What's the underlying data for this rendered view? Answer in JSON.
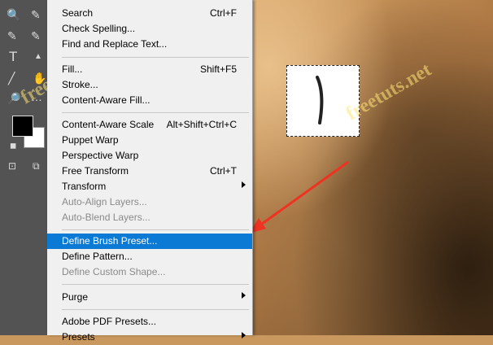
{
  "colors": {
    "menu_bg": "#f0f0f0",
    "highlight": "#0a7ad4",
    "disabled_text": "#8a8a8a",
    "toolbar_bg": "#535353",
    "arrow": "#ee3322"
  },
  "toolbar": {
    "tools": [
      {
        "icon": "zoom-icon",
        "glyph": "🔍"
      },
      {
        "icon": "brush-icon",
        "glyph": "✎"
      },
      {
        "icon": "text-tool-icon",
        "glyph": "T"
      },
      {
        "icon": "path-select-icon",
        "glyph": "▲"
      },
      {
        "icon": "line-tool-icon",
        "glyph": "╱"
      },
      {
        "icon": "hand-tool-icon",
        "glyph": "✋"
      },
      {
        "icon": "magnify-icon",
        "glyph": "🔎"
      },
      {
        "icon": "more-tools-icon",
        "glyph": "…"
      }
    ]
  },
  "menu": {
    "items": [
      {
        "label": "Search",
        "shortcut": "Ctrl+F"
      },
      {
        "label": "Check Spelling..."
      },
      {
        "label": "Find and Replace Text..."
      },
      {
        "label": "Fill...",
        "shortcut": "Shift+F5"
      },
      {
        "label": "Stroke..."
      },
      {
        "label": "Content-Aware Fill..."
      },
      {
        "label": "Content-Aware Scale",
        "shortcut": "Alt+Shift+Ctrl+C"
      },
      {
        "label": "Puppet Warp"
      },
      {
        "label": "Perspective Warp"
      },
      {
        "label": "Free Transform",
        "shortcut": "Ctrl+T"
      },
      {
        "label": "Transform",
        "submenu": true
      },
      {
        "label": "Auto-Align Layers...",
        "disabled": true
      },
      {
        "label": "Auto-Blend Layers...",
        "disabled": true
      },
      {
        "label": "Define Brush Preset...",
        "highlighted": true
      },
      {
        "label": "Define Pattern..."
      },
      {
        "label": "Define Custom Shape...",
        "disabled": true
      },
      {
        "label": "Purge",
        "submenu": true
      },
      {
        "label": "Adobe PDF Presets..."
      },
      {
        "label": "Presets",
        "submenu": true
      }
    ]
  },
  "watermark": "freetuts.net"
}
